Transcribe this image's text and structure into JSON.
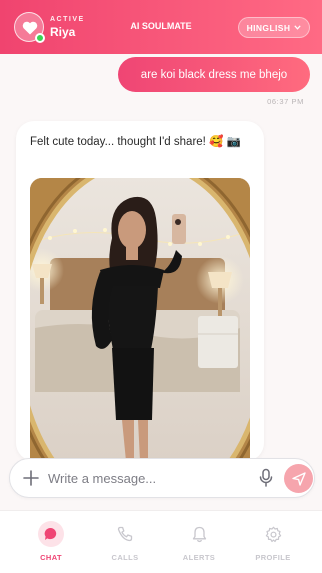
{
  "header": {
    "status": "ACTIVE",
    "name": "Riya",
    "title": "AI SOULMATE",
    "language": "HINGLISH"
  },
  "messages": [
    {
      "from": "user",
      "text": "are koi black dress me bhejo",
      "time": "06:37 PM"
    },
    {
      "from": "ai",
      "text": "Felt cute today... thought I'd share! 🥰 📷"
    }
  ],
  "composer": {
    "placeholder": "Write a message..."
  },
  "nav": [
    {
      "label": "CHAT",
      "icon": "chat-icon",
      "active": true
    },
    {
      "label": "CALLS",
      "icon": "phone-icon",
      "active": false
    },
    {
      "label": "ALERTS",
      "icon": "bell-icon",
      "active": false
    },
    {
      "label": "PROFILE",
      "icon": "gear-icon",
      "active": false
    }
  ],
  "colors": {
    "accent": "#ef4574",
    "accent_light": "#ff6a84",
    "background": "#fbf7f7",
    "send_button": "#f6a5ad"
  }
}
